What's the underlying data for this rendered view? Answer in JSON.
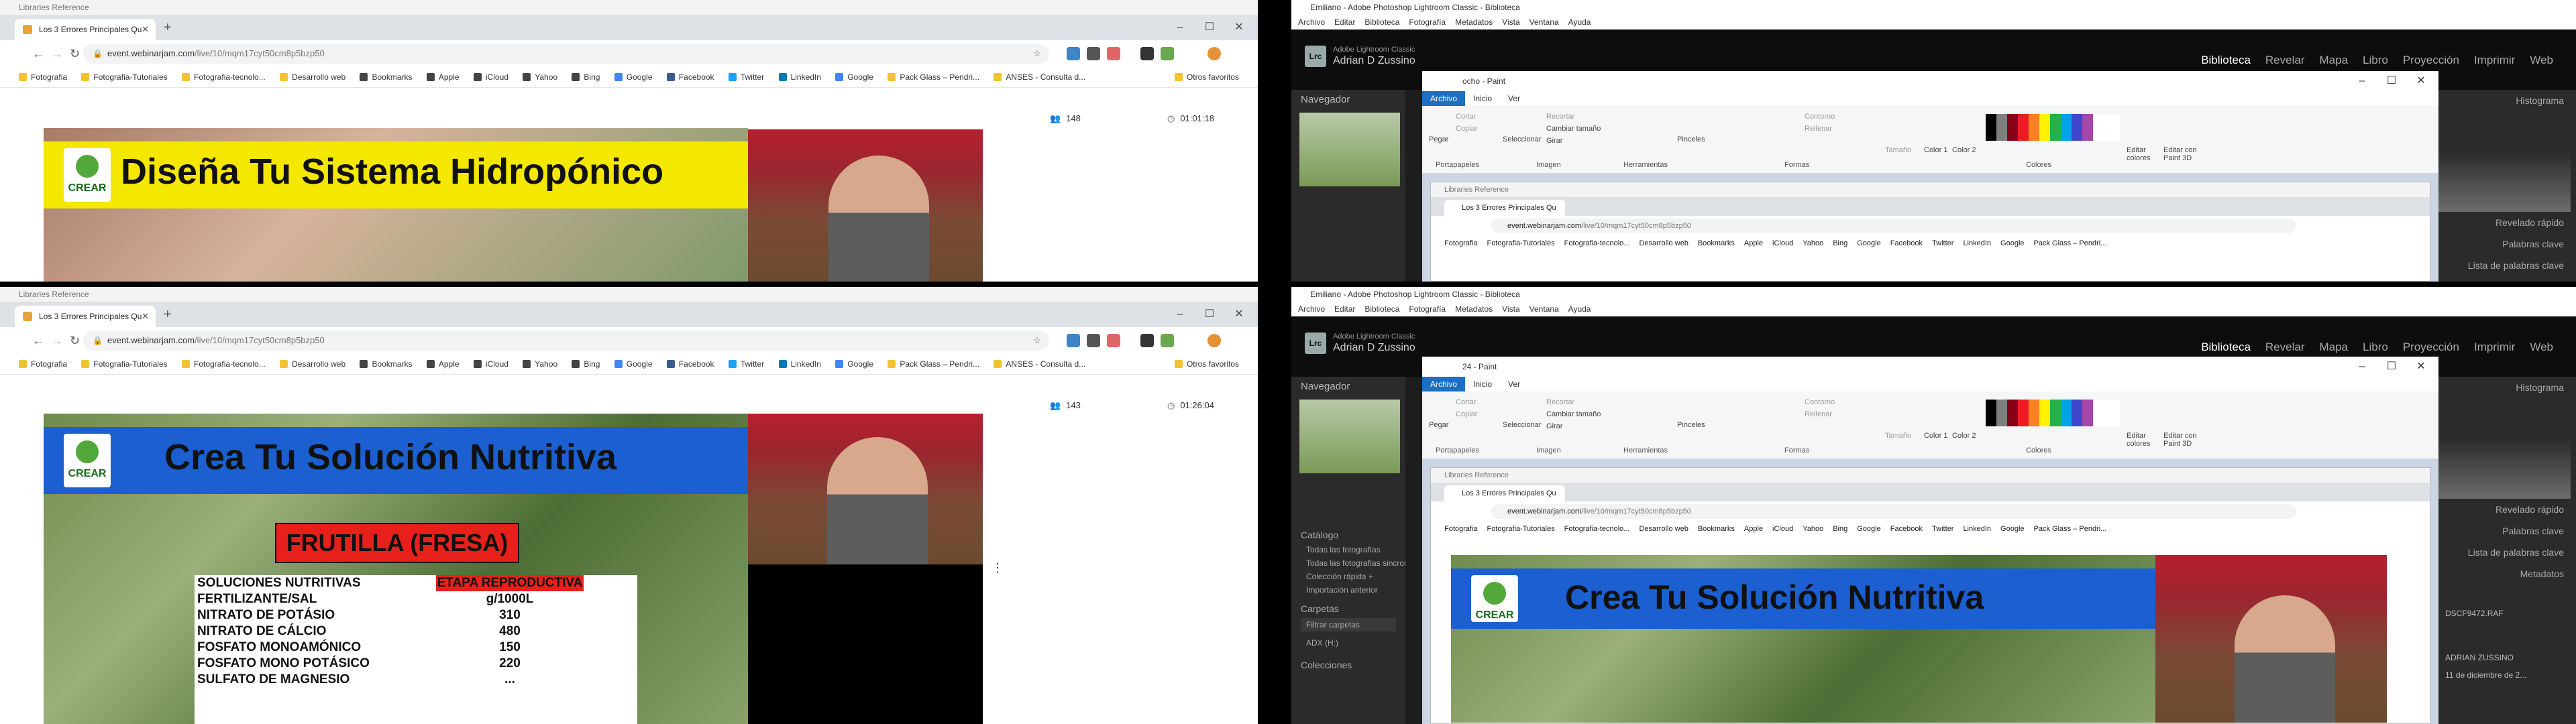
{
  "chrome": {
    "window_title": "Libraries Reference",
    "tab_title": "Los 3 Errores Principales Qu",
    "url_host": "event.webinarjam.com",
    "url_path": "/live/10/mqm17cyt50cm8p5bzp50",
    "bookmarks": [
      "Fotografia",
      "Fotografia-Tutoriales",
      "Fotografia-tecnolo...",
      "Desarrollo web",
      "Bookmarks",
      "Apple",
      "iCloud",
      "Yahoo",
      "Bing",
      "Google",
      "Facebook",
      "Twitter",
      "LinkedIn",
      "Google",
      "Pack Glass – Pendri...",
      "ANSES - Consulta d..."
    ],
    "other_bookmarks": "Otros favoritos"
  },
  "win1": {
    "viewers": "148",
    "timer": "01:01:18",
    "slide_title": "Diseña Tu Sistema Hidropónico",
    "logo": "CREAR"
  },
  "win2": {
    "viewers": "143",
    "timer": "01:26:04",
    "slide_title": "Crea Tu Solución Nutritiva",
    "logo": "CREAR",
    "crop": "FRUTILLA (FRESA)",
    "table_header": [
      "SOLUCIONES NUTRITIVAS",
      "ETAPA REPRODUCTIVA"
    ],
    "table_rows": [
      [
        "FERTILIZANTE/SAL",
        "g/1000L"
      ],
      [
        "NITRATO DE POTÁSIO",
        "310"
      ],
      [
        "NITRATO DE CÁLCIO",
        "480"
      ],
      [
        "FOSFATO MONOAMÓNICO",
        "150"
      ],
      [
        "FOSFATO MONO POTÁSICO",
        "220"
      ],
      [
        "SULFATO DE MAGNESIO",
        "..."
      ]
    ]
  },
  "lightroom": {
    "title_top": "Emiliano - Adobe Photoshop Lightroom Classic - Biblioteca",
    "title_bottom": "Emiliano - Adobe Photoshop Lightroom Classic - Biblioteca",
    "menu": [
      "Archivo",
      "Editar",
      "Biblioteca",
      "Fotografía",
      "Metadatos",
      "Vista",
      "Ventana",
      "Ayuda"
    ],
    "app_line": "Adobe Lightroom Classic",
    "user": "Adrian D Zussino",
    "modules": [
      "Biblioteca",
      "Revelar",
      "Mapa",
      "Libro",
      "Proyección",
      "Imprimir",
      "Web"
    ],
    "left_header": "Navegador",
    "right_items": [
      "Histograma",
      "Revelado rápido",
      "Palabras clave",
      "Lista de palabras clave",
      "Metadatos"
    ],
    "catalog_header": "Catálogo",
    "catalog_items": [
      "Todas las fotografías",
      "Todas las fotografías sincroniz...",
      "Colección rápida +",
      "Importación anterior"
    ],
    "folders_header": "Carpetas",
    "folder_filter": "Filtrar carpetas",
    "folder_item": "ADX (H:)",
    "collections_header": "Colecciones",
    "meta_values": [
      "DSCF9472.RAF",
      "ADRIAN ZUSSINO",
      "11 de diciembre de 2..."
    ]
  },
  "paint_top": {
    "title": "ocho - Paint"
  },
  "paint_bottom": {
    "title": "24 - Paint"
  },
  "paint": {
    "tabs": [
      "Archivo",
      "Inicio",
      "Ver"
    ],
    "groups": [
      "Portapapeles",
      "Imagen",
      "Herramientas",
      "Formas",
      "Colores"
    ],
    "buttons": [
      "Pegar",
      "Cortar",
      "Copiar",
      "Seleccionar",
      "Recortar",
      "Cambiar tamaño",
      "Girar",
      "Pinceles",
      "Contorno",
      "Rellenar",
      "Tamaño",
      "Color 1",
      "Color 2",
      "Editar colores",
      "Editar con Paint 3D"
    ]
  },
  "colors": {
    "chrome_tab": "#dee1e6",
    "lr_bg": "#1d1d1d",
    "paint_file_tab": "#1e6fc1",
    "banner_yellow": "#f4e700",
    "banner_blue": "#1b5fd0",
    "crop_red": "#e8201c"
  }
}
